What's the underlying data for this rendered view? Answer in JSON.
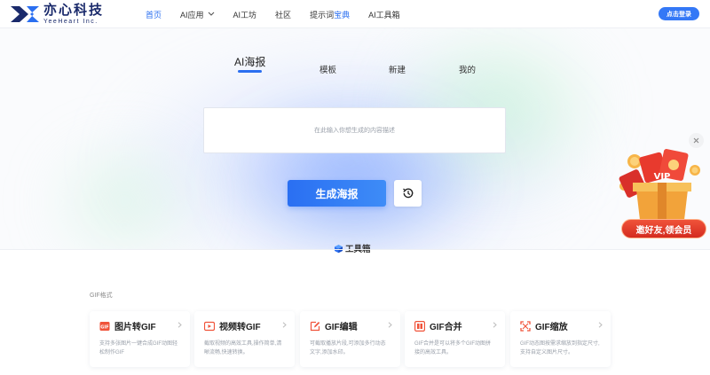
{
  "brand": {
    "name_cn": "亦心科技",
    "name_en": "YeeHeart Inc."
  },
  "nav": {
    "items": [
      {
        "label": "首页",
        "active": true
      },
      {
        "label": "AI应用",
        "dropdown": true
      },
      {
        "label": "AI工坊"
      },
      {
        "label": "社区"
      },
      {
        "label_prefix": "提示词",
        "label_highlight": "宝典"
      },
      {
        "label": "AI工具箱"
      }
    ],
    "login_label": "点击登录"
  },
  "tabs": [
    {
      "label": "AI海报",
      "active": true
    },
    {
      "label": "模板"
    },
    {
      "label": "新建"
    },
    {
      "label": "我的"
    }
  ],
  "prompt": {
    "placeholder": "在此输入你想生成的内容描述"
  },
  "generate_button": "生成海报",
  "toolbox": {
    "title": "工具箱"
  },
  "section": {
    "label": "GIF格式"
  },
  "cards": [
    {
      "title": "图片转GIF",
      "icon": "image-gif-icon",
      "desc": "支持多张图片一键合成GIF动图轻松制作GIF"
    },
    {
      "title": "视频转GIF",
      "icon": "video-gif-icon",
      "desc": "截取视频的高效工具,操作简单,清晰流畅,快速转换。"
    },
    {
      "title": "GIF编辑",
      "icon": "gif-edit-icon",
      "desc": "可截取播放片段,可添加多行动态文字,添加水印。"
    },
    {
      "title": "GIF合并",
      "icon": "gif-merge-icon",
      "desc": "GIF合并是可以将多个GIF动图拼接的高效工具。"
    },
    {
      "title": "GIF缩放",
      "icon": "gif-resize-icon",
      "desc": "GIF动态图按需求缩放到指定尺寸,支持自定义图片尺寸。"
    }
  ],
  "promo": {
    "banner": "邀好友,领会员",
    "badge": "VIP"
  },
  "colors": {
    "accent": "#2b6ff0",
    "icon_red": "#f0533a",
    "promo_red": "#d42b1f"
  }
}
